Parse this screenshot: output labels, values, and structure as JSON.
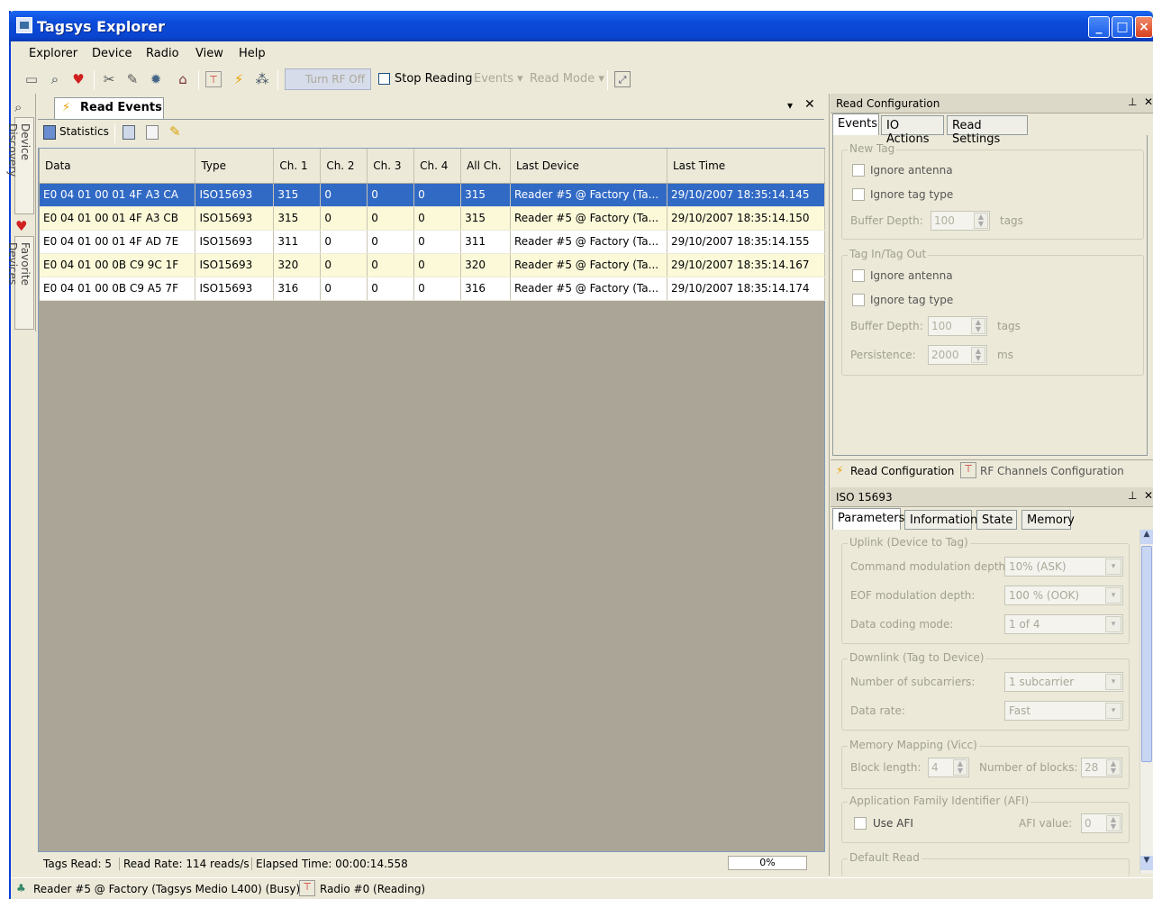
{
  "window": {
    "title": "Tagsys Explorer"
  },
  "menu": [
    "Explorer",
    "Device",
    "Radio",
    "View",
    "Help"
  ],
  "toolbar": {
    "turn_rf_off": "Turn RF Off",
    "stop_reading": "Stop Reading",
    "events": "Events",
    "read_mode": "Read Mode"
  },
  "dock": {
    "device_discovery": "Device Discovery",
    "favorite_devices": "Favorite Devices"
  },
  "doc": {
    "tab_label": "Read Events",
    "statistics_label": "Statistics"
  },
  "table": {
    "columns": [
      "Data",
      "Type",
      "Ch. 1",
      "Ch. 2",
      "Ch. 3",
      "Ch. 4",
      "All Ch.",
      "Last Device",
      "Last Time"
    ],
    "rows": [
      [
        "E0 04 01 00 01 4F A3 CA",
        "ISO15693",
        "315",
        "0",
        "0",
        "0",
        "315",
        "Reader #5 @ Factory (Ta...",
        "29/10/2007 18:35:14.145"
      ],
      [
        "E0 04 01 00 01 4F A3 CB",
        "ISO15693",
        "315",
        "0",
        "0",
        "0",
        "315",
        "Reader #5 @ Factory (Ta...",
        "29/10/2007 18:35:14.150"
      ],
      [
        "E0 04 01 00 01 4F AD 7E",
        "ISO15693",
        "311",
        "0",
        "0",
        "0",
        "311",
        "Reader #5 @ Factory (Ta...",
        "29/10/2007 18:35:14.155"
      ],
      [
        "E0 04 01 00 0B C9 9C 1F",
        "ISO15693",
        "320",
        "0",
        "0",
        "0",
        "320",
        "Reader #5 @ Factory (Ta...",
        "29/10/2007 18:35:14.167"
      ],
      [
        "E0 04 01 00 0B C9 A5 7F",
        "ISO15693",
        "316",
        "0",
        "0",
        "0",
        "316",
        "Reader #5 @ Factory (Ta...",
        "29/10/2007 18:35:14.174"
      ]
    ]
  },
  "status": {
    "tags_read": "Tags Read: 5",
    "read_rate": "Read Rate: 114 reads/s",
    "elapsed": "Elapsed Time: 00:00:14.558",
    "progress": "0%",
    "device": "Reader #5 @ Factory (Tagsys Medio L400) (Busy)",
    "radio": "Radio #0 (Reading)"
  },
  "read_config": {
    "title": "Read Configuration",
    "tabs": [
      "Events",
      "IO Actions",
      "Read Settings"
    ],
    "new_tag": {
      "label": "New Tag",
      "ignore_antenna": "Ignore antenna",
      "ignore_tag_type": "Ignore tag type",
      "buffer_depth_label": "Buffer Depth:",
      "buffer_depth": "100",
      "unit": "tags"
    },
    "tag_in_out": {
      "label": "Tag In/Tag Out",
      "ignore_antenna": "Ignore antenna",
      "ignore_tag_type": "Ignore tag type",
      "buffer_depth_label": "Buffer Depth:",
      "buffer_depth": "100",
      "unit": "tags",
      "persistence_label": "Persistence:",
      "persistence": "2000",
      "persistence_unit": "ms"
    }
  },
  "bottom_tabs": [
    "Read Configuration",
    "RF Channels Configuration"
  ],
  "iso": {
    "title": "ISO 15693",
    "tabs": [
      "Parameters",
      "Information",
      "State",
      "Memory"
    ],
    "uplink": {
      "label": "Uplink (Device to Tag)",
      "cmd_mod_label": "Command modulation depth:",
      "cmd_mod": "10% (ASK)",
      "eof_mod_label": "EOF modulation depth:",
      "eof_mod": "100 % (OOK)",
      "coding_label": "Data coding mode:",
      "coding": "1 of 4"
    },
    "downlink": {
      "label": "Downlink (Tag to Device)",
      "subcarriers_label": "Number of subcarriers:",
      "subcarriers": "1 subcarrier",
      "rate_label": "Data rate:",
      "rate": "Fast"
    },
    "memory": {
      "label": "Memory Mapping (Vicc)",
      "block_len_label": "Block length:",
      "block_len": "4",
      "num_blocks_label": "Number of blocks:",
      "num_blocks": "28"
    },
    "afi": {
      "label": "Application Family Identifier (AFI)",
      "use_afi": "Use AFI",
      "afi_value_label": "AFI value:",
      "afi_value": "0"
    },
    "default_read": {
      "label": "Default Read"
    }
  }
}
